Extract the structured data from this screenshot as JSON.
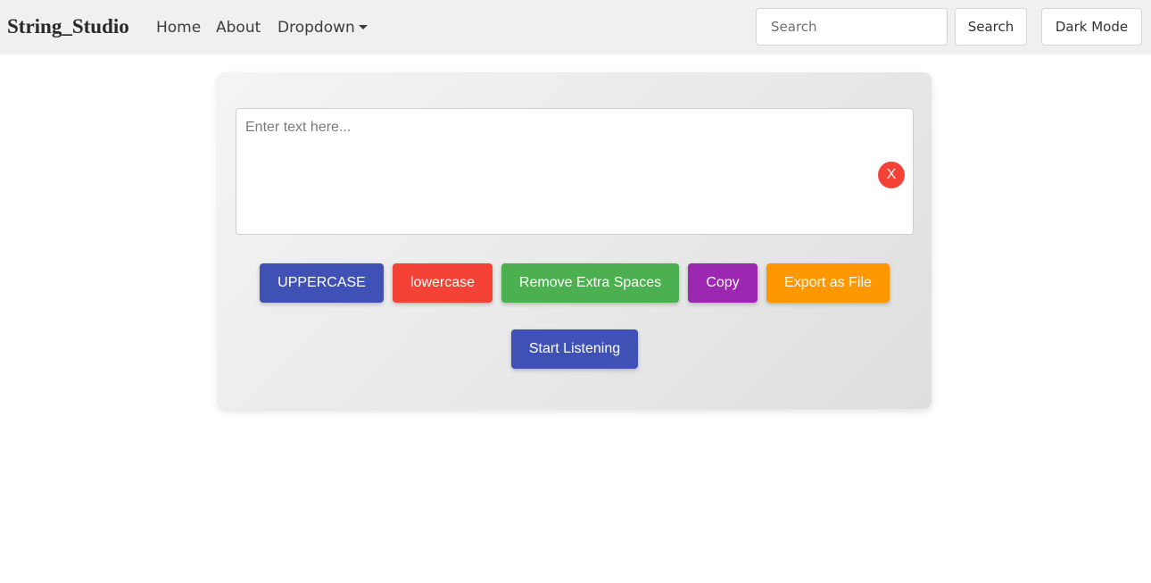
{
  "navbar": {
    "brand": "String_Studio",
    "links": {
      "home": "Home",
      "about": "About",
      "dropdown": "Dropdown"
    },
    "search": {
      "placeholder": "Search",
      "value": "",
      "button_label": "Search"
    },
    "dark_mode_label": "Dark Mode"
  },
  "editor": {
    "placeholder": "Enter text here...",
    "value": "",
    "clear_label": "X"
  },
  "actions": {
    "uppercase": "UPPERCASE",
    "lowercase": "lowercase",
    "remove_spaces": "Remove Extra Spaces",
    "copy": "Copy",
    "export": "Export as File",
    "listen": "Start Listening"
  },
  "colors": {
    "primary_blue": "#3f51b5",
    "red": "#f44336",
    "green": "#4caf50",
    "purple": "#9c27b0",
    "orange": "#ff9800",
    "navbar_bg": "#f0f0f0"
  },
  "icons": {
    "dropdown_caret": "caret-down-icon"
  }
}
